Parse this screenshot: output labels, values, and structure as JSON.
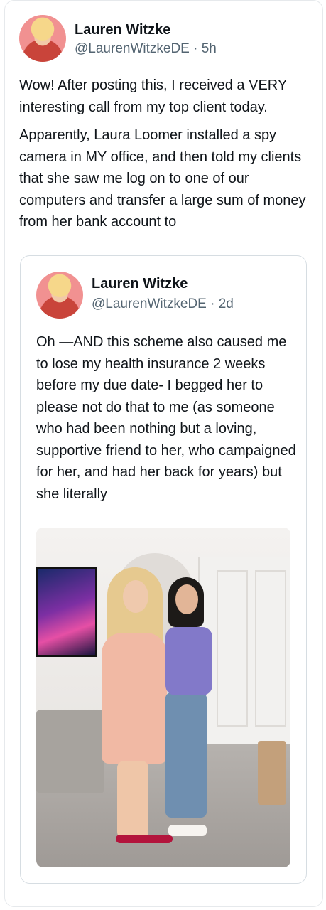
{
  "post": {
    "author_name": "Lauren Witzke",
    "handle_time": "@LaurenWitzkeDE · 5h",
    "paragraph_1": "Wow! After posting this, I received a VERY interesting call from my top client today.",
    "paragraph_2": "Apparently, Laura Loomer installed a spy camera in MY office, and then told my clients that she saw me log on to one of our computers and transfer a large sum of money from her bank account to"
  },
  "quoted": {
    "author_name": "Lauren Witzke",
    "handle_time": "@LaurenWitzkeDE · 2d",
    "text": "Oh —AND this scheme also caused me to lose my health insurance 2 weeks before my due date- I begged her to please not do that to me (as someone who had been nothing but a loving, supportive friend to her, who campaigned for her, and had her back for years) but she literally"
  },
  "colors": {
    "text": "#0f1419",
    "secondary": "#536471",
    "border": "#d6dde2",
    "avatar_bg": "#f19191"
  },
  "icons": [
    "avatar-image",
    "quoted-avatar-image",
    "attached-photo"
  ]
}
